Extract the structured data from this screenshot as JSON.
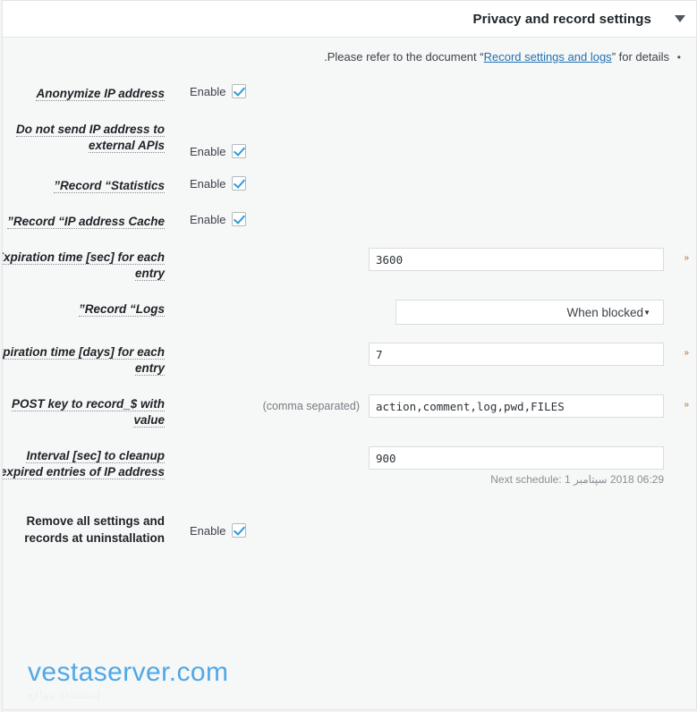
{
  "panel": {
    "title": "Privacy and record settings",
    "toggle_icon": "chevron-down-icon"
  },
  "intro": {
    "text_before": ".Please refer to the document “",
    "link_text": "Record settings and logs",
    "text_after": "” for details",
    "bullet": "•"
  },
  "marker": "«",
  "rows": [
    {
      "label": "Anonymize IP address",
      "enable_text": "Enable",
      "checked": true,
      "type": "checkbox",
      "marker": ""
    },
    {
      "label": "Do not send IP address to external APIs",
      "enable_text": "Enable",
      "checked": true,
      "type": "checkbox",
      "marker": ""
    },
    {
      "label": "”Record “Statistics",
      "enable_text": "Enable",
      "checked": true,
      "type": "checkbox",
      "marker": ""
    },
    {
      "label": "”Record “IP address Cache",
      "enable_text": "Enable",
      "checked": true,
      "type": "checkbox",
      "marker": ""
    },
    {
      "label": "Expiration time [sec] for each entry",
      "value": "3600",
      "type": "text",
      "marker": "«"
    },
    {
      "label": "”Record “Logs",
      "value": "When blocked",
      "type": "select",
      "arrow": "▼",
      "marker": ""
    },
    {
      "label": "Expiration time [days] for each entry",
      "value": "7",
      "type": "text",
      "marker": "«"
    },
    {
      "label": "POST key to record_$ with value",
      "value": "action,comment,log,pwd,FILES",
      "hint": "(comma separated)",
      "type": "text",
      "marker": "«"
    },
    {
      "label": "Interval [sec] to cleanup expired entries of IP address",
      "value": "900",
      "note": "06:29 2018 سپتامبر Next schedule: 1",
      "type": "text",
      "marker": ""
    },
    {
      "label": "Remove all settings and records at uninstallation",
      "enable_text": "Enable",
      "checked": true,
      "type": "checkbox",
      "plain_label": true,
      "marker": ""
    }
  ],
  "watermark": {
    "main": "vestaserver.com",
    "sub": "إستضافة مواقع"
  },
  "colors": {
    "accent": "#2271b1",
    "checkmark": "#2e9bd6",
    "panel_bg": "#f6f7f7",
    "header_bg": "#ffffff",
    "title": "#1d2327",
    "marker": "#b26a28",
    "watermark": "#4fa8e8"
  }
}
